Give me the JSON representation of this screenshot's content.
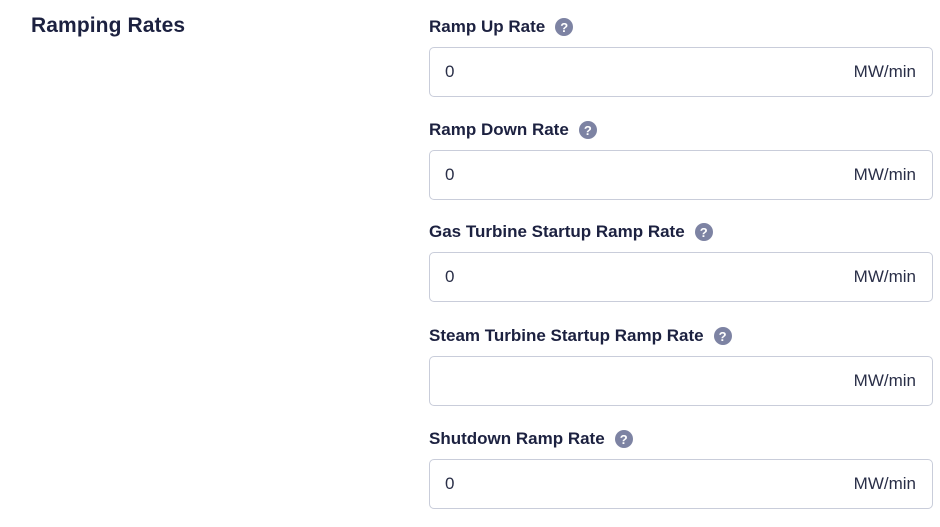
{
  "section": {
    "title": "Ramping Rates"
  },
  "fields": [
    {
      "label": "Ramp Up Rate",
      "value": "0",
      "unit": "MW/min",
      "help_icon": "question-circle"
    },
    {
      "label": "Ramp Down Rate",
      "value": "0",
      "unit": "MW/min",
      "help_icon": "question-circle"
    },
    {
      "label": "Gas Turbine Startup Ramp Rate",
      "value": "0",
      "unit": "MW/min",
      "help_icon": "question-circle"
    },
    {
      "label": "Steam Turbine Startup Ramp Rate",
      "value": "",
      "unit": "MW/min",
      "help_icon": "question-circle"
    },
    {
      "label": "Shutdown Ramp Rate",
      "value": "0",
      "unit": "MW/min",
      "help_icon": "question-circle"
    }
  ],
  "colors": {
    "text": "#1c2140",
    "help_icon_bg": "#7d83a3",
    "input_border": "#c9cdda"
  }
}
